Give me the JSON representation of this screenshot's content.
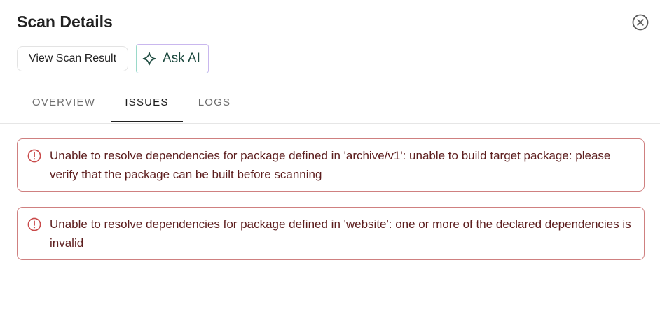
{
  "dialog": {
    "title": "Scan Details",
    "close_icon": "close-circle-icon"
  },
  "actions": {
    "view_scan_result_label": "View Scan Result",
    "ask_ai_label": "Ask AI",
    "ask_ai_icon": "sparkle-diamond-icon"
  },
  "tabs": [
    {
      "label": "OVERVIEW",
      "active": false
    },
    {
      "label": "ISSUES",
      "active": true
    },
    {
      "label": "LOGS",
      "active": false
    }
  ],
  "issues": [
    {
      "icon": "alert-circle-icon",
      "message": "Unable to resolve dependencies for package defined in 'archive/v1': unable to build target package: please verify that the package can be built before scanning"
    },
    {
      "icon": "alert-circle-icon",
      "message": "Unable to resolve dependencies for package defined in 'website': one or more of the declared dependencies is invalid"
    }
  ],
  "colors": {
    "error_border": "#cf8080",
    "error_text": "#5c1d1d",
    "error_icon": "#c94a4a",
    "active_tab": "#1a1a1a",
    "inactive_tab": "#6d6d6d",
    "ai_text": "#1d4a3f"
  }
}
